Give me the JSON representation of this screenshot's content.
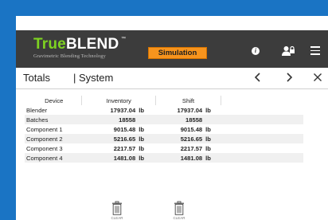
{
  "app": {
    "brand_true": "True",
    "brand_blend": "BLEND",
    "trademark": "™",
    "tagline": "Gravimetric Blending Technology",
    "mode_label": "Simulation",
    "info_glyph": "i"
  },
  "icons": {
    "info": "info-icon",
    "user": "user-lock-icon",
    "menu": "hamburger-menu-icon",
    "prev": "chevron-left-icon",
    "next": "chevron-right-icon",
    "close": "close-icon",
    "trash": "trash-icon"
  },
  "nav": {
    "title": "Totals",
    "subtitle": "| System",
    "prev_glyph": "‹",
    "next_glyph": "›",
    "close_glyph": "✕"
  },
  "table": {
    "headers": {
      "device": "Device",
      "inventory": "Inventory",
      "shift": "Shift"
    },
    "rows": [
      {
        "device": "Blender",
        "inventory": "17937.04",
        "inv_unit": "lb",
        "shift": "17937.04",
        "shift_unit": "lb"
      },
      {
        "device": "Batches",
        "inventory": "18558",
        "inv_unit": "",
        "shift": "18558",
        "shift_unit": ""
      },
      {
        "device": "Component 1",
        "inventory": "9015.48",
        "inv_unit": "lb",
        "shift": "9015.48",
        "shift_unit": "lb"
      },
      {
        "device": "Component 2",
        "inventory": "5216.65",
        "inv_unit": "lb",
        "shift": "5216.65",
        "shift_unit": "lb"
      },
      {
        "device": "Component 3",
        "inventory": "2217.57",
        "inv_unit": "lb",
        "shift": "2217.57",
        "shift_unit": "lb"
      },
      {
        "device": "Component 4",
        "inventory": "1481.08",
        "inv_unit": "lb",
        "shift": "1481.08",
        "shift_unit": "lb"
      }
    ]
  },
  "actions": {
    "clear_inventory_label": "CLEAR",
    "clear_shift_label": "CLEAR"
  },
  "colors": {
    "frame": "#1a74c4",
    "header": "#3c3c3c",
    "brand_green": "#7ed321",
    "mode_orange": "#f7941d"
  }
}
